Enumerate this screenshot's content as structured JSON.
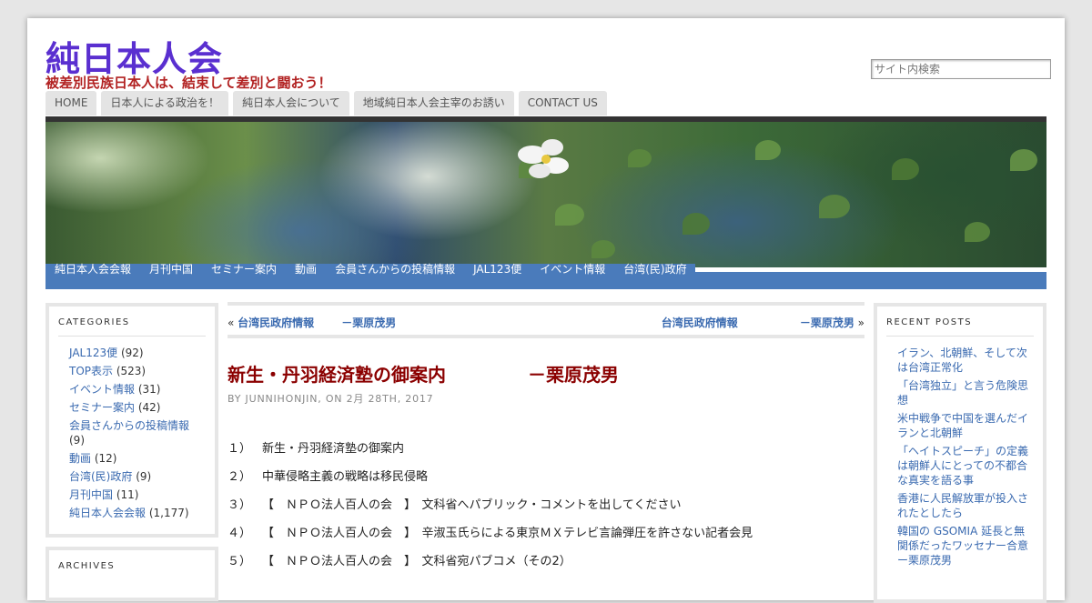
{
  "site": {
    "title": "純日本人会",
    "description": "被差別民族日本人は、結束して差別と闘おう！",
    "search_placeholder": "サイト内検索"
  },
  "top_nav": [
    "HOME",
    "日本人による政治を！",
    "純日本人会について",
    "地域純日本人会主宰のお誘い",
    "CONTACT US"
  ],
  "category_nav": [
    "純日本人会会報",
    "月刊中国",
    "セミナー案内",
    "動画",
    "会員さんからの投稿情報",
    "JAL123便",
    "イベント情報",
    "台湾(民)政府"
  ],
  "sidebar_left": {
    "categories_heading": "CATEGORIES",
    "categories": [
      {
        "name": "JAL123便",
        "count": "(92)"
      },
      {
        "name": "TOP表示",
        "count": "(523)"
      },
      {
        "name": "イベント情報",
        "count": "(31)"
      },
      {
        "name": "セミナー案内",
        "count": "(42)"
      },
      {
        "name": "会員さんからの投稿情報",
        "count": "(9)"
      },
      {
        "name": "動画",
        "count": "(12)"
      },
      {
        "name": "台湾(民)政府",
        "count": "(9)"
      },
      {
        "name": "月刊中国",
        "count": "(11)"
      },
      {
        "name": "純日本人会会報",
        "count": "(1,177)"
      }
    ],
    "archives_heading": "ARCHIVES"
  },
  "post_nav": {
    "prev_arrow": "«",
    "prev_a": "台湾民政府情報",
    "prev_b": "－栗原茂男",
    "next_a": "台湾民政府情報",
    "next_b": "－栗原茂男",
    "next_arrow": "»"
  },
  "post": {
    "title_a": "新生・丹羽経済塾の御案内",
    "title_b": "－栗原茂男",
    "byline": "BY JUNNIHONJIN, ON 2月 28TH, 2017",
    "items": [
      {
        "num": "１）",
        "text": "新生・丹羽経済塾の御案内"
      },
      {
        "num": "２）",
        "text": "中華侵略主義の戦略は移民侵略"
      },
      {
        "num": "３）",
        "text": "【　ＮＰＯ法人百人の会　】　文科省へパブリック・コメントを出してください"
      },
      {
        "num": "４）",
        "text": "【　ＮＰＯ法人百人の会　】　辛淑玉氏らによる東京ＭＸテレビ言論弾圧を許さない記者会見"
      },
      {
        "num": "５）",
        "text": "【　ＮＰＯ法人百人の会　】　文科省宛パブコメ（その2）"
      }
    ]
  },
  "sidebar_right": {
    "heading": "RECENT POSTS",
    "posts": [
      "イラン、北朝鮮、そして次は台湾正常化",
      "「台湾独立」と言う危険思想",
      "米中戦争で中国を選んだイランと北朝鮮",
      "「ヘイトスピーチ」の定義は朝鮮人にとっての不都合な真実を語る事",
      "香港に人民解放軍が投入されたとしたら",
      "韓国の GSOMIA 延長と無関係だったワッセナー合意　　　　ー栗原茂男"
    ]
  }
}
